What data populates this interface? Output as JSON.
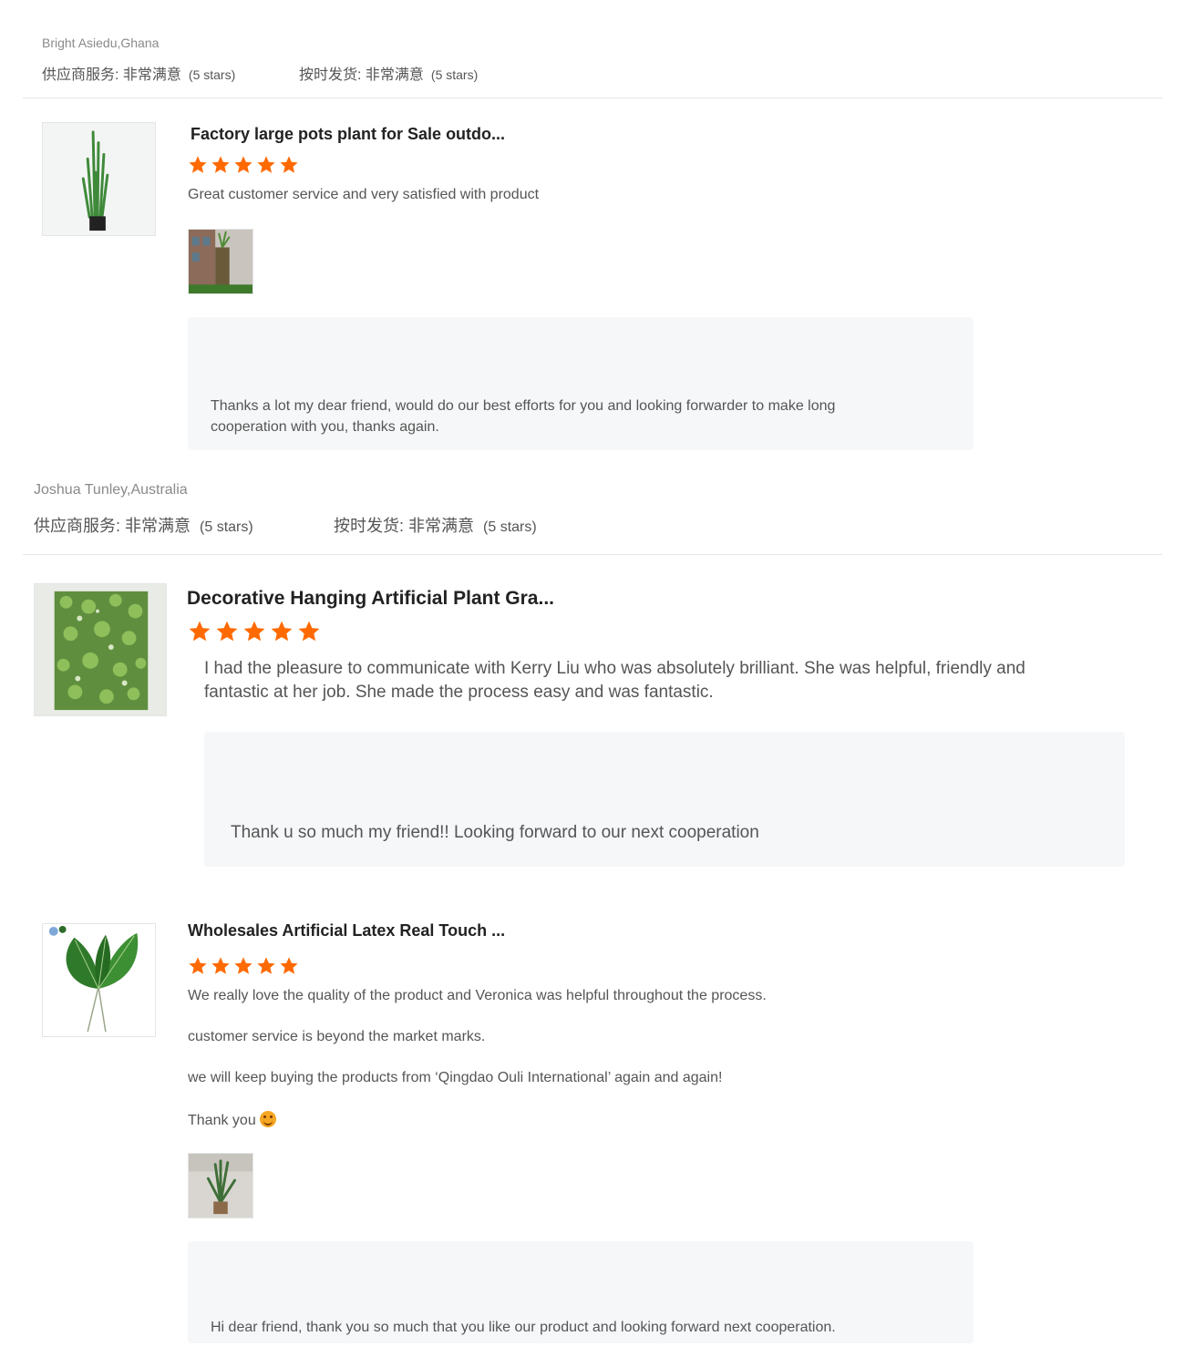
{
  "reviews": [
    {
      "reviewer": "Bright Asiedu,Ghana",
      "supplier_service": "供应商服务: 非常满意",
      "supplier_service_stars": "(5 stars)",
      "on_time_delivery": "按时发货: 非常满意",
      "on_time_delivery_stars": "(5 stars)",
      "product_title": "Factory large pots plant for Sale outdo...",
      "rating": 5,
      "comment_lines": [
        "Great customer service and very satisfied with product"
      ],
      "has_attached_photo": true,
      "reply": [
        "Thanks a lot my dear friend,  would do our best efforts for you and looking forwarder to make long",
        "cooperation with you, thanks again."
      ]
    },
    {
      "reviewer": "Joshua Tunley,Australia",
      "supplier_service": "供应商服务: 非常满意",
      "supplier_service_stars": "(5 stars)",
      "on_time_delivery": "按时发货: 非常满意",
      "on_time_delivery_stars": "(5 stars)",
      "product_title": "Decorative Hanging Artificial Plant Gra...",
      "rating": 5,
      "comment_lines": [
        "I had the pleasure to communicate with Kerry Liu who was absolutely brilliant. She was helpful, friendly and",
        "fantastic at her job. She made the process easy and was fantastic."
      ],
      "has_attached_photo": false,
      "reply": [
        "Thank u so much  my friend!!  Looking forward to our next cooperation"
      ]
    },
    {
      "product_title": "Wholesales   Artificial Latex Real Touch ...",
      "rating": 5,
      "comment_lines": [
        "We really love the quality of the product and Veronica was helpful throughout the process.",
        "customer service is beyond the market marks.",
        "we will keep buying the products from ‘Qingdao Ouli International’ again and again!",
        "Thank you"
      ],
      "has_attached_photo": true,
      "reply": [
        "Hi dear friend, thank you so much that you like our product and looking forward next cooperation."
      ]
    }
  ],
  "colors": {
    "star": "#ff6a00",
    "reply_bg": "#f6f7f9",
    "divider": "#e6e6e6"
  },
  "icons": {
    "star": "star-icon",
    "emoji": "smiling-face-emoji"
  }
}
